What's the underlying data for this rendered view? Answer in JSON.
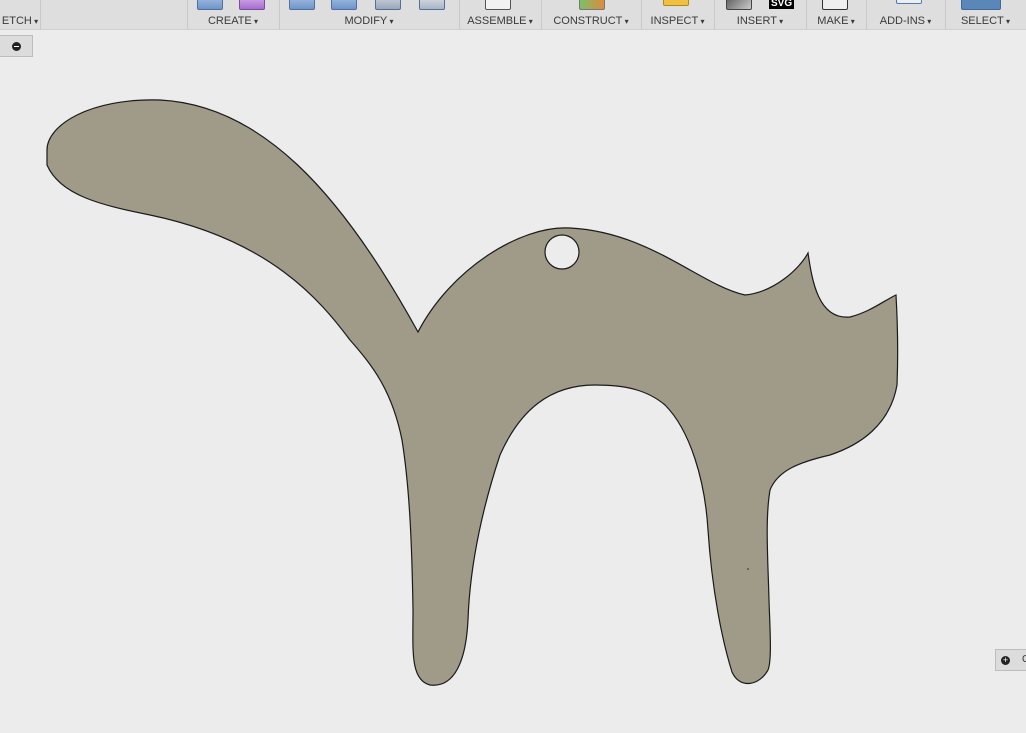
{
  "toolbar": {
    "groups": [
      {
        "label": "ETCH"
      },
      {
        "label": "CREATE"
      },
      {
        "label": "MODIFY"
      },
      {
        "label": "ASSEMBLE"
      },
      {
        "label": "CONSTRUCT"
      },
      {
        "label": "INSPECT"
      },
      {
        "label": "INSERT"
      },
      {
        "label": "MAKE"
      },
      {
        "label": "ADD-INS"
      },
      {
        "label": "SELECT"
      }
    ],
    "insert_svg_badge": "SVG"
  },
  "viewport": {
    "sketch_fill": "#a09a88",
    "background": "#ececec",
    "comments_partial_label": "C"
  }
}
